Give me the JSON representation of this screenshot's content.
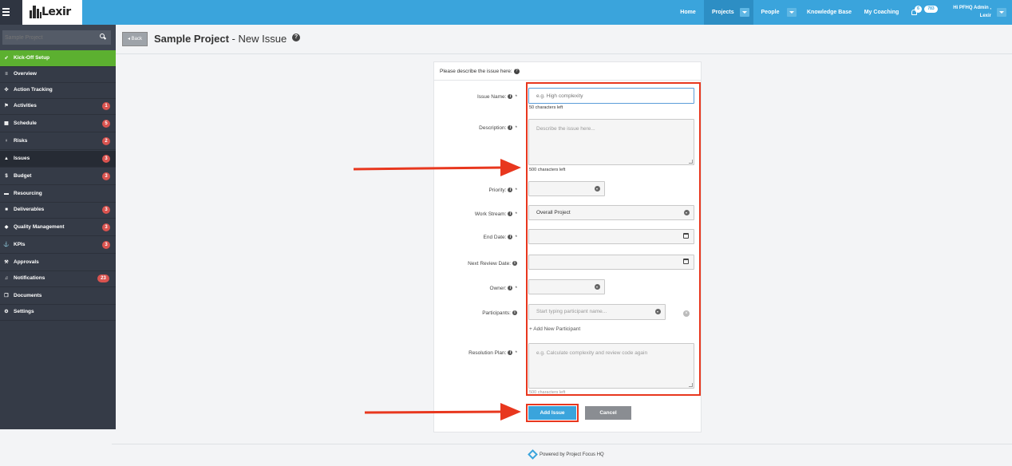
{
  "app": {
    "logo_text": "Lexir",
    "brand_color": "#3aa4dc",
    "highlight_color": "#e8371e"
  },
  "topnav": {
    "home": "Home",
    "projects": "Projects",
    "people": "People",
    "knowledge_base": "Knowledge Base",
    "my_coaching": "My Coaching",
    "notif_count_1": "6",
    "notif_count_2": "783",
    "greeting": "Hi PFHQ Admin ,",
    "username": "Lexir"
  },
  "sidebar": {
    "search_placeholder": "Sample Project",
    "items": [
      {
        "label": "Kick-Off Setup",
        "icon": "rocket-icon",
        "count": ""
      },
      {
        "label": "Overview",
        "icon": "overview-icon",
        "count": ""
      },
      {
        "label": "Action Tracking",
        "icon": "action-icon",
        "count": ""
      },
      {
        "label": "Activities",
        "icon": "flag-icon",
        "count": "1"
      },
      {
        "label": "Schedule",
        "icon": "calendar-icon",
        "count": "5"
      },
      {
        "label": "Risks",
        "icon": "bulb-icon",
        "count": "2"
      },
      {
        "label": "Issues",
        "icon": "warning-icon",
        "count": "3"
      },
      {
        "label": "Budget",
        "icon": "dollar-icon",
        "count": "3"
      },
      {
        "label": "Resourcing",
        "icon": "folder-icon",
        "count": ""
      },
      {
        "label": "Deliverables",
        "icon": "box-icon",
        "count": "3"
      },
      {
        "label": "Quality Management",
        "icon": "tag-icon",
        "count": "3"
      },
      {
        "label": "KPIs",
        "icon": "anchor-icon",
        "count": "3"
      },
      {
        "label": "Approvals",
        "icon": "gavel-icon",
        "count": ""
      },
      {
        "label": "Notifications",
        "icon": "bell-icon",
        "count": "23"
      },
      {
        "label": "Documents",
        "icon": "docs-icon",
        "count": ""
      },
      {
        "label": "Settings",
        "icon": "cogs-icon",
        "count": ""
      }
    ]
  },
  "header": {
    "back_label": "Back",
    "project_name": "Sample Project",
    "page_suffix": " - New Issue",
    "help": "?"
  },
  "form": {
    "intro": "Please describe the issue here:",
    "issue_name": {
      "label": "Issue Name:",
      "placeholder": "e.g. High complexity",
      "chars_left": "50 characters left"
    },
    "description": {
      "label": "Description:",
      "placeholder": "Describe the issue here...",
      "chars_left": "500 characters left"
    },
    "priority": {
      "label": "Priority:",
      "value": ""
    },
    "work_stream": {
      "label": "Work Stream:",
      "value": "Overall Project"
    },
    "end_date": {
      "label": "End Date:",
      "value": ""
    },
    "next_review_date": {
      "label": "Next Review Date:",
      "value": ""
    },
    "owner": {
      "label": "Owner:",
      "value": ""
    },
    "participants": {
      "label": "Participants:",
      "placeholder": "Start typing participant name...",
      "add_label": "+ Add New Participant"
    },
    "resolution_plan": {
      "label": "Resolution Plan:",
      "placeholder": "e.g. Calculate complexity and review code again",
      "chars_left": "500 characters left"
    },
    "required_mark": "*",
    "info_mark": "i",
    "clear_mark": "×",
    "add_button": "Add Issue",
    "cancel_button": "Cancel"
  },
  "footer": {
    "text": "Powered by Project Focus HQ"
  }
}
